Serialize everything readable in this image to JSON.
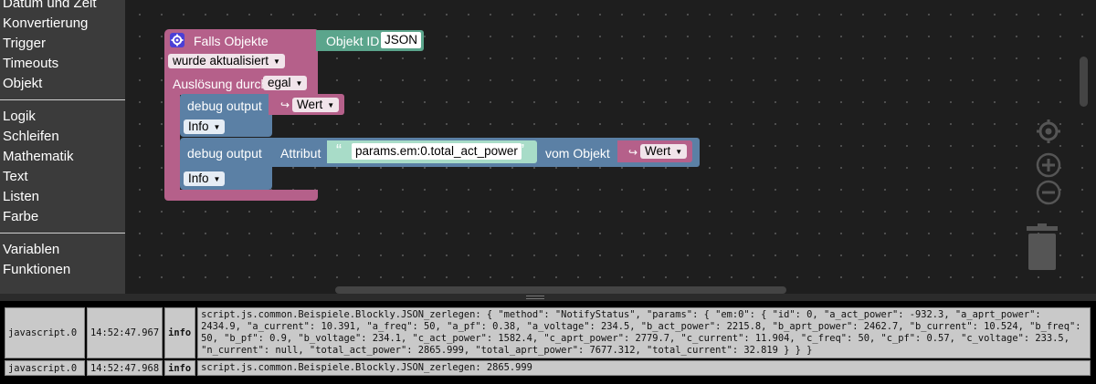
{
  "toolbox": {
    "group1": [
      "Datum und Zeit",
      "Konvertierung",
      "Trigger",
      "Timeouts",
      "Objekt"
    ],
    "group2": [
      "Logik",
      "Schleifen",
      "Mathematik",
      "Text",
      "Listen",
      "Farbe"
    ],
    "group3": [
      "Variablen",
      "Funktionen"
    ]
  },
  "trigger_block": {
    "title": "Falls Objekte",
    "object_id_label": "Objekt ID",
    "object_id_value": "JSON",
    "condition": "wurde aktualisiert",
    "triggered_by_label": "Auslösung durch",
    "triggered_by_value": "egal"
  },
  "debug1": {
    "label": "debug output",
    "level": "Info",
    "value_var": "Wert"
  },
  "debug2": {
    "label": "debug output",
    "level": "Info",
    "attr_label": "Attribut",
    "quote_open": "“",
    "attribute": "params.em:0.total_act_power",
    "quote_close": "”",
    "from_object_label": "vom Objekt",
    "value_var": "Wert"
  },
  "icons": {
    "settings": "gear-icon",
    "center": "crosshair-icon",
    "zoom_in": "plus-icon",
    "zoom_out": "minus-icon",
    "trash": "trash-icon",
    "var_arrow": "↪"
  },
  "log": {
    "rows": [
      {
        "source": "javascript.0",
        "time": "14:52:47.967",
        "level": "info",
        "message": "script.js.common.Beispiele.Blockly.JSON_zerlegen: { \"method\": \"NotifyStatus\", \"params\": { \"em:0\": { \"id\": 0, \"a_act_power\": -932.3, \"a_aprt_power\":\n2434.9, \"a_current\": 10.391, \"a_freq\": 50, \"a_pf\": 0.38, \"a_voltage\": 234.5, \"b_act_power\": 2215.8, \"b_aprt_power\": 2462.7, \"b_current\": 10.524, \"b_freq\":\n50, \"b_pf\": 0.9, \"b_voltage\": 234.1, \"c_act_power\": 1582.4, \"c_aprt_power\": 2779.7, \"c_current\": 11.904, \"c_freq\": 50, \"c_pf\": 0.57, \"c_voltage\": 233.5,\n\"n_current\": null, \"total_act_power\": 2865.999, \"total_aprt_power\": 7677.312, \"total_current\": 32.819 } } }"
      },
      {
        "source": "javascript.0",
        "time": "14:52:47.968",
        "level": "info",
        "message": "script.js.common.Beispiele.Blockly.JSON_zerlegen: 2865.999"
      }
    ]
  }
}
